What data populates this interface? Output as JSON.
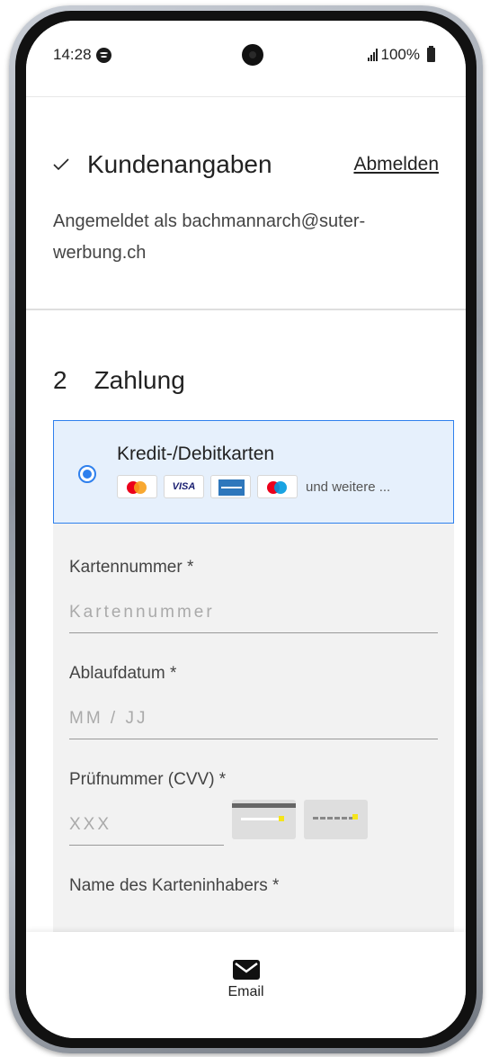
{
  "status_bar": {
    "time": "14:28",
    "battery": "100%"
  },
  "section1": {
    "title": "Kundenangaben",
    "logout_label": "Abmelden",
    "logged_in_text": "Angemeldet als bachmannarch@suter-werbung.ch"
  },
  "section2": {
    "number": "2",
    "title": "Zahlung",
    "payment_option": {
      "label": "Kredit-/Debitkarten",
      "more_text": "und weitere ...",
      "selected": true,
      "cards": [
        "mastercard-icon",
        "visa-icon",
        "amex-icon",
        "maestro-icon"
      ],
      "visa_text": "VISA"
    },
    "fields": {
      "card_number_label": "Kartennummer *",
      "card_number_placeholder": "Kartennummer",
      "expiry_label": "Ablaufdatum *",
      "expiry_placeholder": "MM / JJ",
      "cvv_label": "Prüfnummer (CVV) *",
      "cvv_placeholder": "XXX",
      "holder_label": "Name des Karteninhabers *",
      "holder_placeholder": ""
    }
  },
  "bottom_bar": {
    "email_label": "Email"
  },
  "colors": {
    "accent": "#2f80ed",
    "selected_bg": "#e6f0fc",
    "form_bg": "#f2f2f2"
  }
}
